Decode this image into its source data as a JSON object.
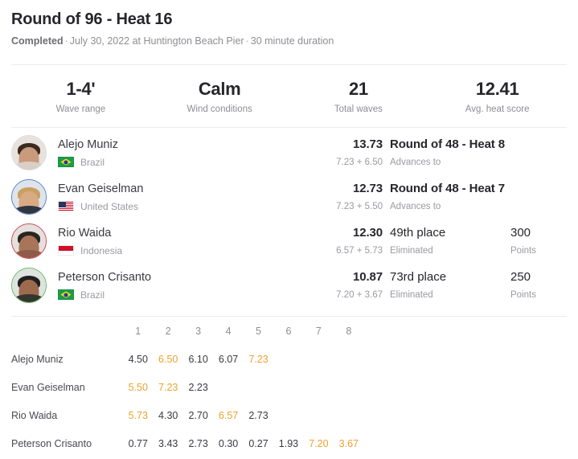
{
  "heat": {
    "title": "Round of 96 - Heat 16",
    "status": "Completed",
    "sep1": "·",
    "date_location": "July 30, 2022 at Huntington Beach Pier",
    "sep2": "·",
    "duration": "30 minute duration"
  },
  "stats": [
    {
      "value": "1-4'",
      "label": "Wave range"
    },
    {
      "value": "Calm",
      "label": "Wind conditions"
    },
    {
      "value": "21",
      "label": "Total waves"
    },
    {
      "value": "12.41",
      "label": "Avg. heat score"
    }
  ],
  "surfers": [
    {
      "name": "Alejo Muniz",
      "country": "Brazil",
      "flag": "flag-br",
      "ring": "ring-gray",
      "total": "13.73",
      "breakdown": "7.23 + 6.50",
      "result_main": "Round of 48 - Heat 8",
      "result_bold": true,
      "result_sub": "Advances to",
      "points": "",
      "points_label": ""
    },
    {
      "name": "Evan Geiselman",
      "country": "United States",
      "flag": "flag-us",
      "ring": "ring-blue",
      "total": "12.73",
      "breakdown": "7.23 + 5.50",
      "result_main": "Round of 48 - Heat 7",
      "result_bold": true,
      "result_sub": "Advances to",
      "points": "",
      "points_label": ""
    },
    {
      "name": "Rio Waida",
      "country": "Indonesia",
      "flag": "flag-id",
      "ring": "ring-red",
      "total": "12.30",
      "breakdown": "6.57 + 5.73",
      "result_main": "49th place",
      "result_bold": false,
      "result_sub": "Eliminated",
      "points": "300",
      "points_label": "Points"
    },
    {
      "name": "Peterson Crisanto",
      "country": "Brazil",
      "flag": "flag-br",
      "ring": "ring-green",
      "total": "10.87",
      "breakdown": "7.20 + 3.67",
      "result_main": "73rd place",
      "result_bold": false,
      "result_sub": "Eliminated",
      "points": "250",
      "points_label": "Points"
    }
  ],
  "wave_table": {
    "columns": [
      "1",
      "2",
      "3",
      "4",
      "5",
      "6",
      "7",
      "8"
    ],
    "rows": [
      {
        "name": "Alejo Muniz",
        "scores": [
          "4.50",
          "6.50",
          "6.10",
          "6.07",
          "7.23",
          "",
          "",
          ""
        ],
        "counted": [
          false,
          true,
          false,
          false,
          true,
          false,
          false,
          false
        ]
      },
      {
        "name": "Evan Geiselman",
        "scores": [
          "5.50",
          "7.23",
          "2.23",
          "",
          "",
          "",
          "",
          ""
        ],
        "counted": [
          true,
          true,
          false,
          false,
          false,
          false,
          false,
          false
        ]
      },
      {
        "name": "Rio Waida",
        "scores": [
          "5.73",
          "4.30",
          "2.70",
          "6.57",
          "2.73",
          "",
          "",
          ""
        ],
        "counted": [
          true,
          false,
          false,
          true,
          false,
          false,
          false,
          false
        ]
      },
      {
        "name": "Peterson Crisanto",
        "scores": [
          "0.77",
          "3.43",
          "2.73",
          "0.30",
          "0.27",
          "1.93",
          "7.20",
          "3.67"
        ],
        "counted": [
          false,
          false,
          false,
          false,
          false,
          false,
          true,
          true
        ]
      }
    ]
  },
  "colors": {
    "counted_score": "#eda22e",
    "ring_blue": "#4d7fd0",
    "ring_red": "#d0434a",
    "ring_green": "#62b85a",
    "text_primary": "#26262b",
    "text_muted": "#9a9aa0"
  }
}
